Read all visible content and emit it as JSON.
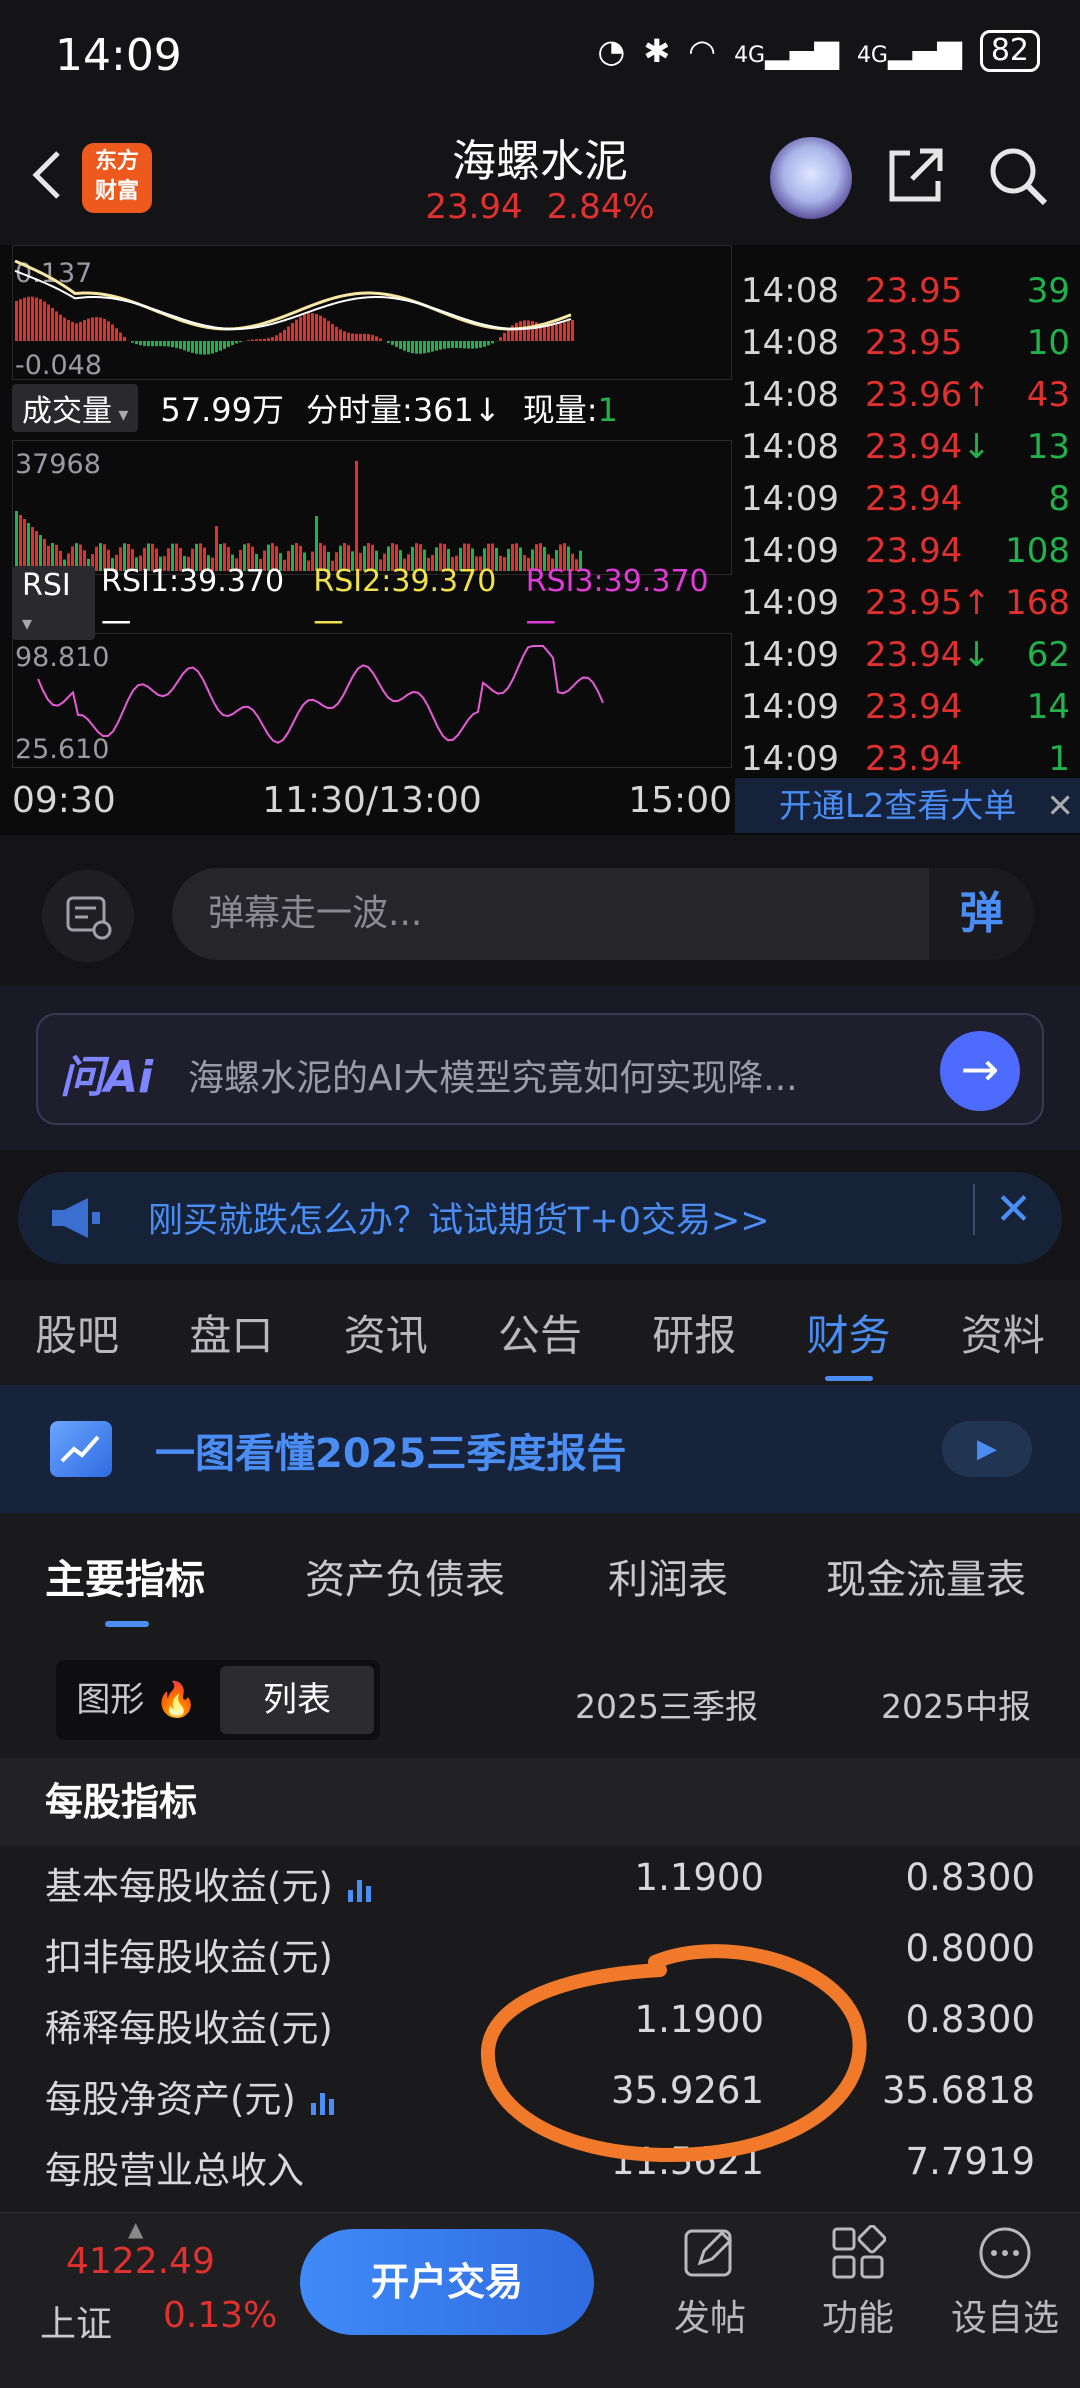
{
  "status": {
    "time": "14:09",
    "net1": "4G",
    "net2": "4G",
    "battery": "82"
  },
  "header": {
    "logo_line1": "东方",
    "logo_line2": "财富",
    "title": "海螺水泥",
    "price": "23.94",
    "change_pct": "2.84%"
  },
  "chart": {
    "macd_top": "0.137",
    "macd_bottom": "-0.048",
    "volume_dropdown": "成交量",
    "total_volume": "57.99万",
    "tick_volume_label": "分时量:361↓",
    "current_volume_label": "现量:",
    "current_volume_value": "1",
    "volume_max": "37968",
    "rsi_dropdown": "RSI",
    "rsi1": "RSI1:39.370一",
    "rsi2": "RSI2:39.370一",
    "rsi3": "RSI3:39.370一",
    "rsi_top": "98.810",
    "rsi_bottom": "25.610",
    "x_start": "09:30",
    "x_mid": "11:30/13:00",
    "x_end": "15:00"
  },
  "trades": [
    {
      "time": "14:08",
      "price": "23.95",
      "arrow": "",
      "vol": "39",
      "dir": "dn"
    },
    {
      "time": "14:08",
      "price": "23.95",
      "arrow": "",
      "vol": "10",
      "dir": "dn"
    },
    {
      "time": "14:08",
      "price": "23.96",
      "arrow": "↑",
      "vol": "43",
      "dir": "up"
    },
    {
      "time": "14:08",
      "price": "23.94",
      "arrow": "↓",
      "vol": "13",
      "dir": "dn"
    },
    {
      "time": "14:09",
      "price": "23.94",
      "arrow": "",
      "vol": "8",
      "dir": "dn"
    },
    {
      "time": "14:09",
      "price": "23.94",
      "arrow": "",
      "vol": "108",
      "dir": "dn"
    },
    {
      "time": "14:09",
      "price": "23.95",
      "arrow": "↑",
      "vol": "168",
      "dir": "up"
    },
    {
      "time": "14:09",
      "price": "23.94",
      "arrow": "↓",
      "vol": "62",
      "dir": "dn"
    },
    {
      "time": "14:09",
      "price": "23.94",
      "arrow": "",
      "vol": "14",
      "dir": "dn"
    },
    {
      "time": "14:09",
      "price": "23.94",
      "arrow": "",
      "vol": "1",
      "dir": "dn"
    }
  ],
  "l2_label": "开通L2查看大单",
  "danmu": {
    "placeholder": "弹幕走一波...",
    "button": "弹"
  },
  "ai": {
    "logo": "问Ai",
    "text": "海螺水泥的AI大模型究竟如何实现降...",
    "go": "→"
  },
  "promo": {
    "text": "刚买就跌怎么办？试试期货T+0交易>>"
  },
  "tabs": [
    "股吧",
    "盘口",
    "资讯",
    "公告",
    "研报",
    "财务",
    "资料"
  ],
  "active_tab": 5,
  "report_banner": "一图看懂2025三季度报告",
  "subtabs": [
    "主要指标",
    "资产负债表",
    "利润表",
    "现金流量表"
  ],
  "toggle": {
    "chart": "图形",
    "list": "列表"
  },
  "periods": [
    "2025三季报",
    "2025中报"
  ],
  "section": "每股指标",
  "rows": [
    {
      "name": "基本每股收益(元)",
      "v1": "1.1900",
      "v2": "0.8300",
      "icon": true
    },
    {
      "name": "扣非每股收益(元)",
      "v1": "",
      "v2": "0.8000",
      "icon": false
    },
    {
      "name": "稀释每股收益(元)",
      "v1": "1.1900",
      "v2": "0.8300",
      "icon": false
    },
    {
      "name": "每股净资产(元)",
      "v1": "35.9261",
      "v2": "35.6818",
      "icon": true
    },
    {
      "name": "每股营业总收入",
      "v1": "11.5621",
      "v2": "7.7919",
      "icon": false
    }
  ],
  "bottom": {
    "index_value": "4122.49",
    "index_name": "上证",
    "index_pct": "0.13%",
    "open_button": "开户交易",
    "nav": [
      "发帖",
      "功能",
      "设自选"
    ]
  },
  "colors": {
    "up": "#e0312f",
    "down": "#21b24c",
    "accent": "#4a8ef5",
    "annotation": "#f07a2a"
  }
}
